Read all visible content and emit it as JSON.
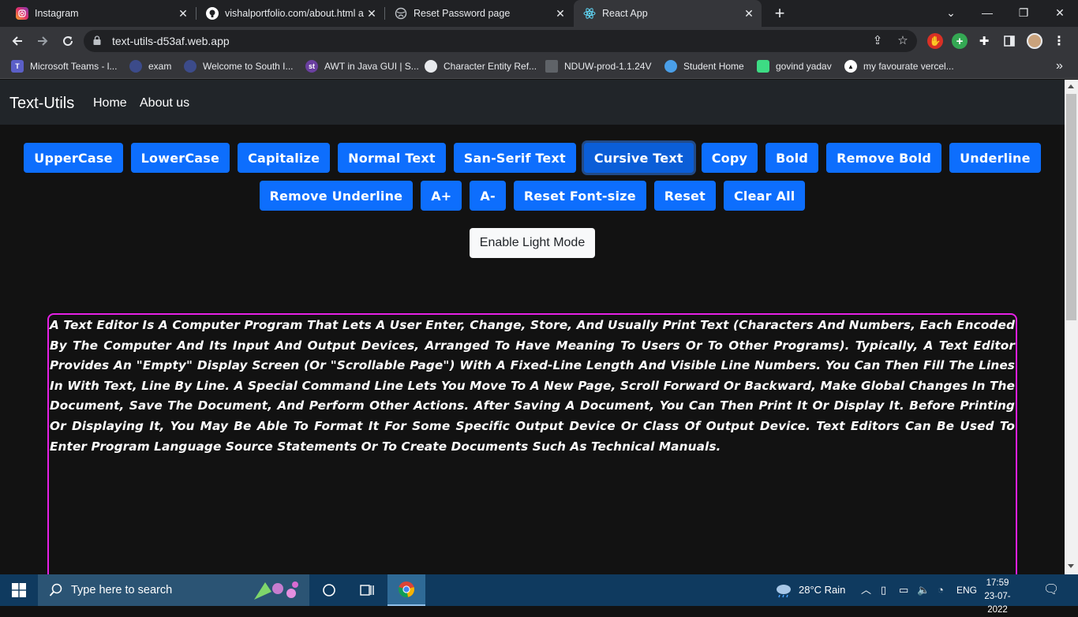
{
  "browser": {
    "tabs": [
      {
        "title": "Instagram",
        "icon": "instagram-icon"
      },
      {
        "title": "vishalportfolio.com/about.html a",
        "icon": "github-icon"
      },
      {
        "title": "Reset Password page",
        "icon": "globe-icon"
      },
      {
        "title": "React App",
        "icon": "react-icon",
        "active": true
      }
    ],
    "url": "text-utils-d53af.web.app",
    "bookmarks": [
      {
        "label": "Microsoft Teams - l...",
        "icon": "teams-icon"
      },
      {
        "label": "exam",
        "icon": "globe-icon"
      },
      {
        "label": "Welcome to South I...",
        "icon": "globe-icon"
      },
      {
        "label": "AWT in Java GUI | S...",
        "icon": "st-icon",
        "badge": "st"
      },
      {
        "label": "Character Entity Ref...",
        "icon": "globe-icon"
      },
      {
        "label": "NDUW-prod-1.1.24V",
        "icon": "doc-icon"
      },
      {
        "label": "Student Home",
        "icon": "shield-icon"
      },
      {
        "label": "govind yadav",
        "icon": "android-icon"
      },
      {
        "label": "my favourate vercel...",
        "icon": "vercel-icon"
      }
    ],
    "more_bookmarks": "»"
  },
  "app": {
    "brand": "Text-Utils",
    "nav": {
      "home": "Home",
      "about": "About us"
    },
    "buttons_row1": [
      "UpperCase",
      "LowerCase",
      "Capitalize",
      "Normal Text",
      "San-Serif Text",
      "Cursive Text",
      "Copy",
      "Bold",
      "Remove Bold",
      "Underline"
    ],
    "buttons_row2": [
      "Remove Underline",
      "A+",
      "A-",
      "Reset Font-size",
      "Reset",
      "Clear All"
    ],
    "focused_button": "Cursive Text",
    "light_mode_label": "Enable Light Mode",
    "editor_text": "A Text Editor Is A Computer Program That Lets A User Enter, Change, Store, And Usually Print Text (Characters And Numbers, Each Encoded By The Computer And Its Input And Output Devices, Arranged To Have Meaning To Users Or To Other Programs). Typically, A Text Editor Provides An \"Empty\" Display Screen (Or \"Scrollable Page\") With A Fixed-Line Length And Visible Line Numbers. You Can Then Fill The Lines In With Text, Line By Line. A Special Command Line Lets You Move To A New Page, Scroll Forward Or Backward, Make Global Changes In The Document, Save The Document, And Perform Other Actions. After Saving A Document, You Can Then Print It Or Display It. Before Printing Or Displaying It, You May Be Able To Format It For Some Specific Output Device Or Class Of Output Device. Text Editors Can Be Used To Enter Program Language Source Statements Or To Create Documents Such As Technical Manuals."
  },
  "taskbar": {
    "search_placeholder": "Type here to search",
    "weather": "28°C  Rain",
    "language": "ENG",
    "time": "17:59",
    "date": "23-07-2022"
  },
  "colors": {
    "primary_button": "#0d6efd",
    "editor_border": "#e620e6",
    "navbar": "#212529",
    "page_bg": "#121212"
  }
}
